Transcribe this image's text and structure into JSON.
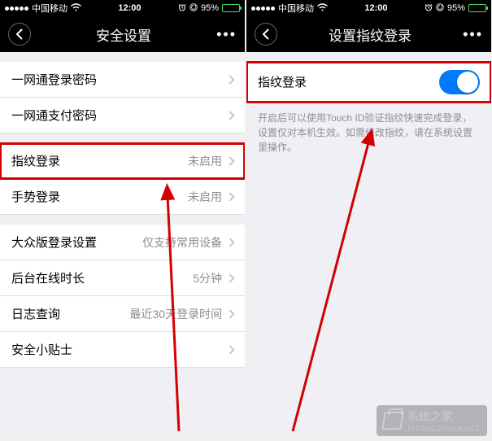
{
  "status": {
    "carrier": "中国移动",
    "time": "12:00",
    "battery_pct": "95%"
  },
  "left": {
    "title": "安全设置",
    "cells": {
      "pw1": "一网通登录密码",
      "pw2": "一网通支付密码",
      "fp_label": "指纹登录",
      "fp_value": "未启用",
      "gesture_label": "手势登录",
      "gesture_value": "未启用",
      "device_label": "大众版登录设置",
      "device_value": "仅支持常用设备",
      "online_label": "后台在线时长",
      "online_value": "5分钟",
      "log_label": "日志查询",
      "log_value": "最近30天登录时间",
      "tips_label": "安全小贴士"
    }
  },
  "right": {
    "title": "设置指纹登录",
    "fp_label": "指纹登录",
    "desc": "开启后可以使用Touch ID验证指纹快速完成登录，设置仅对本机生效。如需修改指纹，请在系统设置里操作。"
  },
  "watermark": {
    "name": "系统之家",
    "url": "XITONGZHIJIA.NET"
  }
}
